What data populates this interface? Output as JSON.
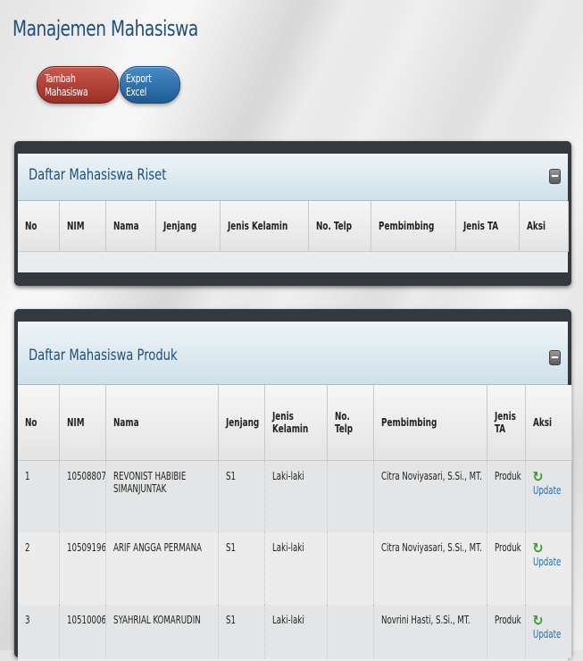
{
  "page": {
    "title": "Manajemen Mahasiswa"
  },
  "buttons": {
    "add": "Tambah Mahasiswa",
    "export": "Export Excel"
  },
  "riset": {
    "title": "Daftar Mahasiswa Riset",
    "headers": [
      "No",
      "NIM",
      "Nama",
      "Jenjang",
      "Jenis Kelamin",
      "No. Telp",
      "Pembimbing",
      "Jenis TA",
      "Aksi"
    ]
  },
  "produk": {
    "title": "Daftar Mahasiswa Produk",
    "headers": [
      "No",
      "NIM",
      "Nama",
      "Jenjang",
      "Jenis Kelamin",
      "No. Telp",
      "Pembimbing",
      "Jenis TA",
      "Aksi"
    ],
    "rows": [
      {
        "no": "1",
        "nim": "10508807",
        "nama": "REVONIST HABIBIE SIMANJUNTAK",
        "jenjang": "S1",
        "jk": "Laki-laki",
        "telp": "",
        "pembimbing": "Citra Noviyasari, S.Si., MT.",
        "jenis_ta": "Produk",
        "aksi": "Update"
      },
      {
        "no": "2",
        "nim": "10509196",
        "nama": "ARIF ANGGA PERMANA",
        "jenjang": "S1",
        "jk": "Laki-laki",
        "telp": "",
        "pembimbing": "Citra Noviyasari, S.Si., MT.",
        "jenis_ta": "Produk",
        "aksi": "Update"
      },
      {
        "no": "3",
        "nim": "10510006",
        "nama": "SYAHRIAL KOMARUDIN",
        "jenjang": "S1",
        "jk": "Laki-laki",
        "telp": "",
        "pembimbing": "Novrini Hasti, S.Si., MT.",
        "jenis_ta": "Produk",
        "aksi": "Update"
      }
    ]
  },
  "icons": {
    "update": "refresh-icon",
    "collapse": "collapse-icon"
  },
  "colors": {
    "title": "#1f4e79",
    "add_button": "#b0392e",
    "export_button": "#2a6aa8",
    "panel_frame": "#34393d",
    "update_icon": "#3b9a2a"
  }
}
